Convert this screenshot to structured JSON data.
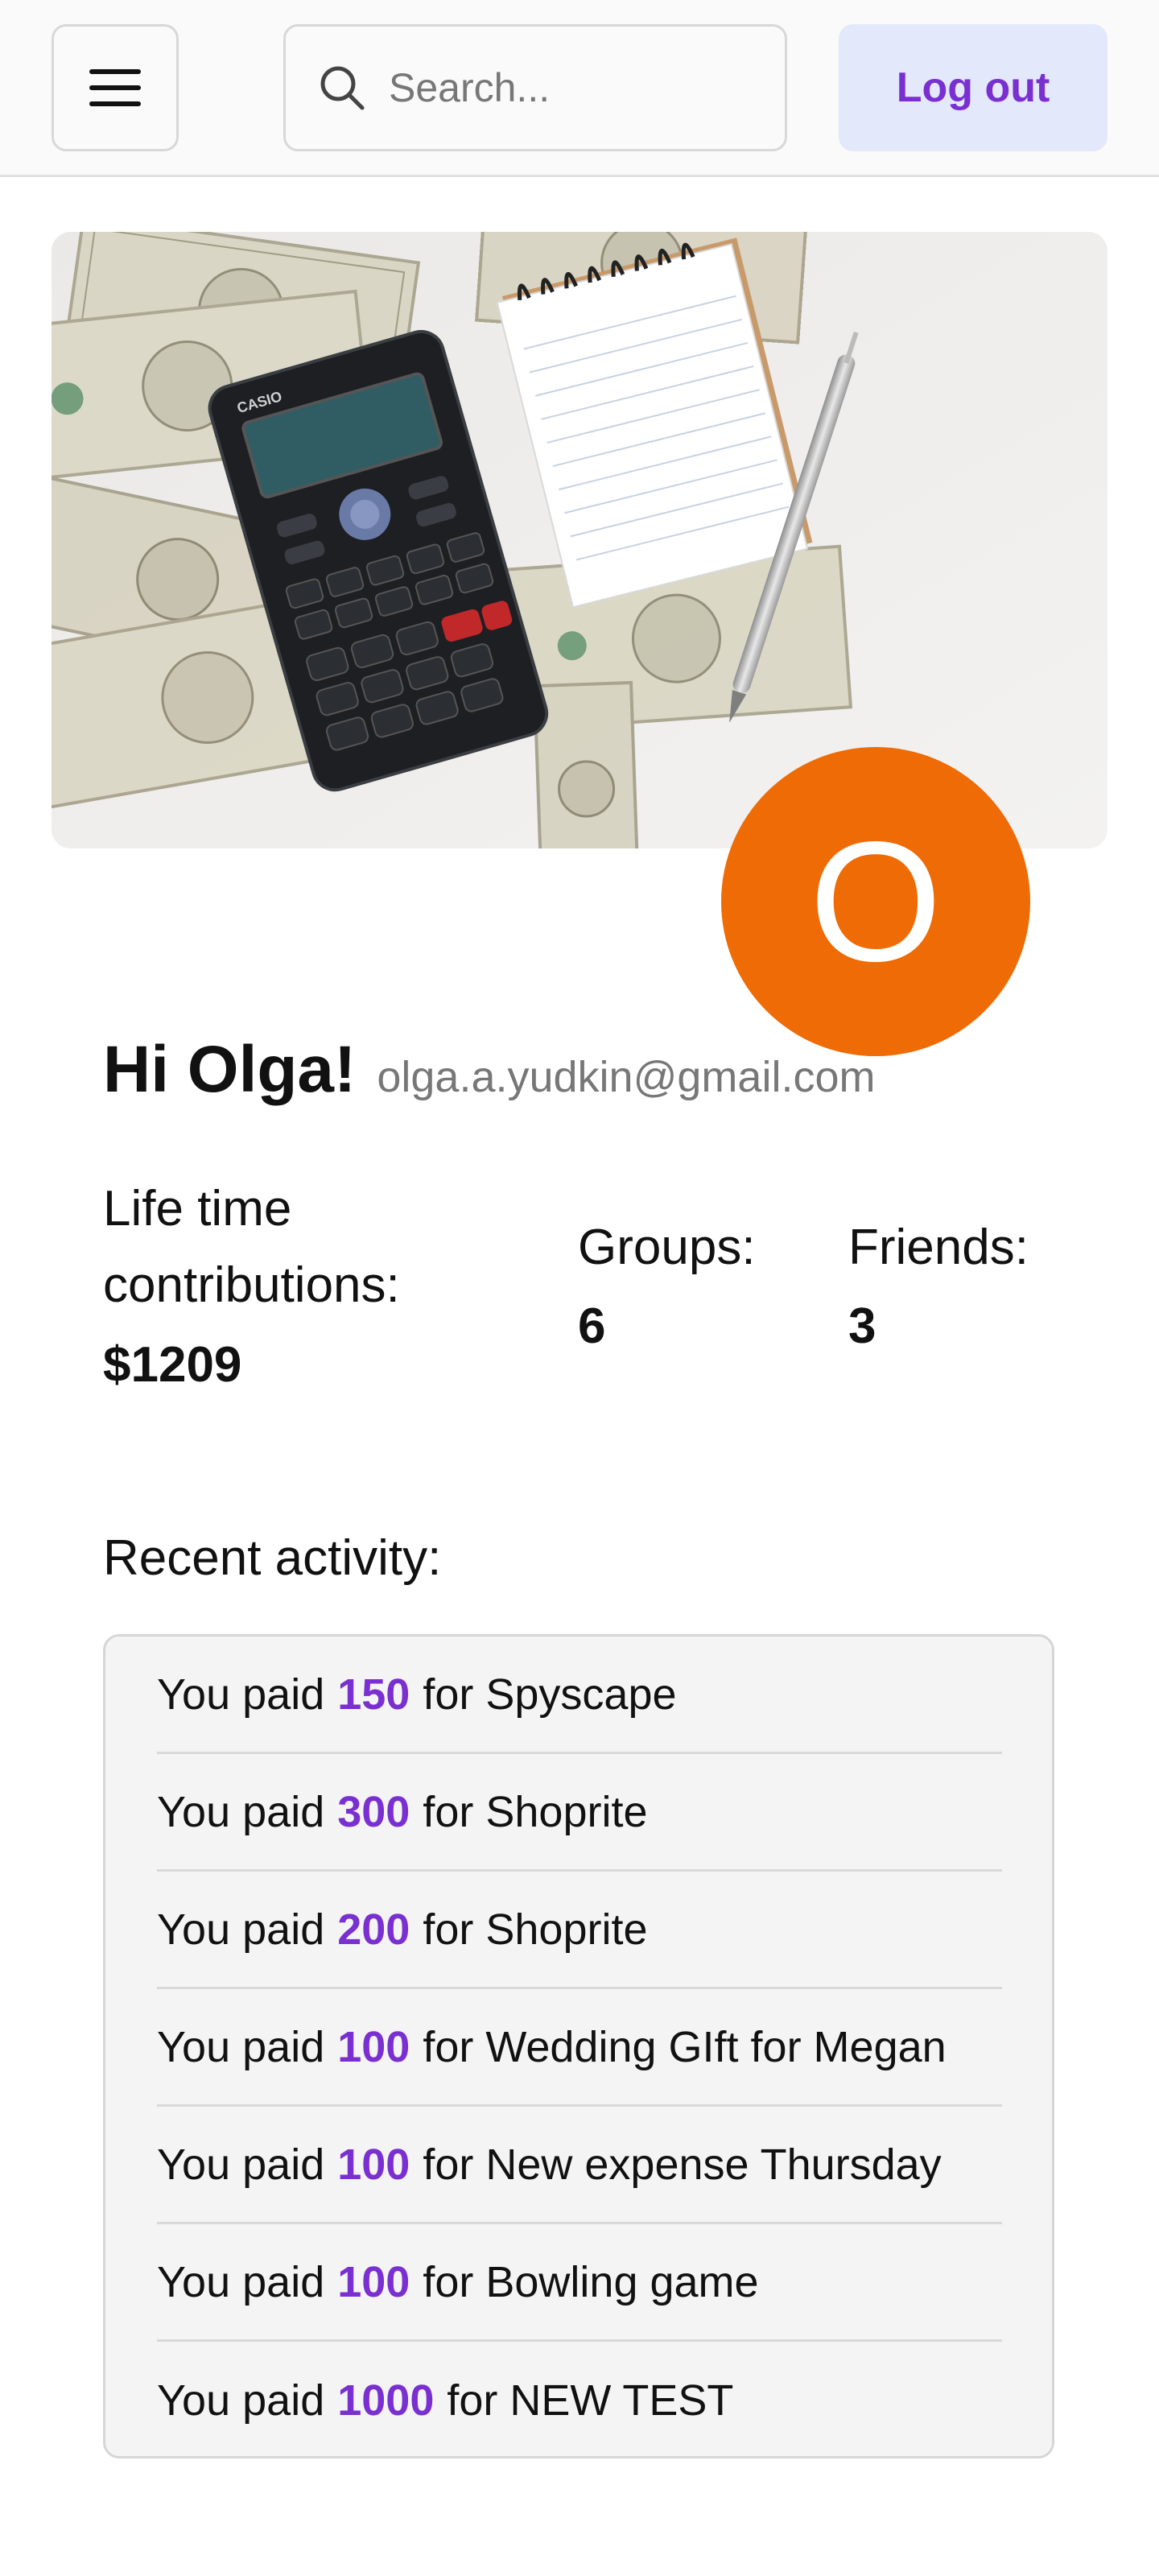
{
  "header": {
    "menu_icon": "hamburger-menu-icon",
    "search_icon": "search-icon",
    "search_placeholder": "Search...",
    "logout_label": "Log out"
  },
  "profile": {
    "avatar_letter": "O",
    "greeting": "Hi Olga!",
    "email": "olga.a.yudkin@gmail.com"
  },
  "stats": {
    "contributions_label_line1": "Life time",
    "contributions_label_line2": "contributions:",
    "contributions_value": "$1209",
    "groups_label": "Groups:",
    "groups_value": "6",
    "friends_label": "Friends:",
    "friends_value": "3"
  },
  "recent": {
    "title": "Recent activity:",
    "items": [
      {
        "prefix": "You paid",
        "amount": "150",
        "suffix": "for Spyscape"
      },
      {
        "prefix": "You paid",
        "amount": "300",
        "suffix": "for Shoprite"
      },
      {
        "prefix": "You paid",
        "amount": "200",
        "suffix": "for Shoprite"
      },
      {
        "prefix": "You paid",
        "amount": "100",
        "suffix": "for Wedding GIft for Megan"
      },
      {
        "prefix": "You paid",
        "amount": "100",
        "suffix": "for New expense Thursday"
      },
      {
        "prefix": "You paid",
        "amount": "100",
        "suffix": "for Bowling game"
      },
      {
        "prefix": "You paid",
        "amount": "1000",
        "suffix": "for NEW TEST"
      }
    ]
  },
  "colors": {
    "accent": "#7a2fd1",
    "avatar_bg": "#ee6b05",
    "logout_bg": "#e3e8fb"
  }
}
